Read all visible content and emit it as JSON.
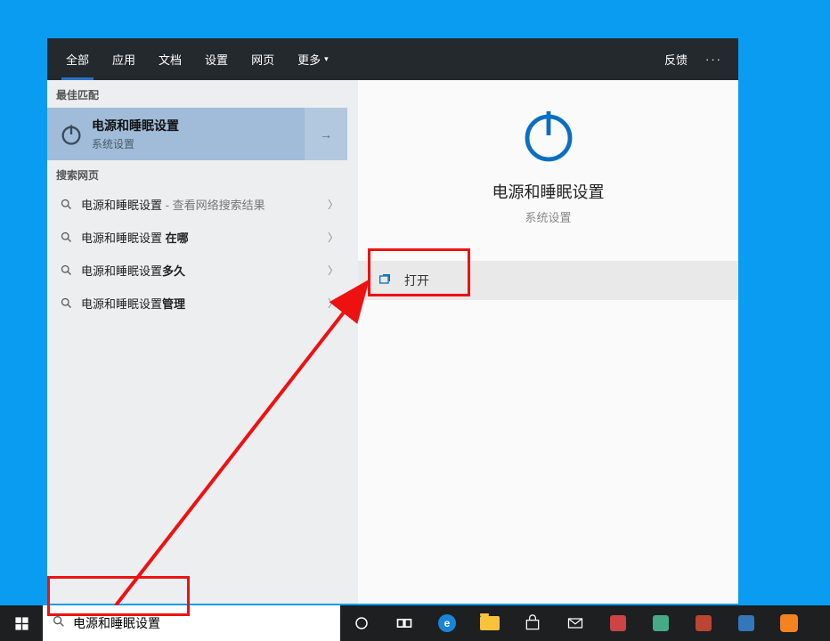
{
  "tabs": [
    "全部",
    "应用",
    "文档",
    "设置",
    "网页",
    "更多"
  ],
  "feedback": "反馈",
  "sections": {
    "best_match": "最佳匹配",
    "web": "搜索网页"
  },
  "best_match": {
    "title": "电源和睡眠设置",
    "subtitle": "系统设置"
  },
  "web_results": [
    {
      "prefix": "电源和睡眠设置",
      "suffix": " - 查看网络搜索结果",
      "bold": ""
    },
    {
      "prefix": "电源和睡眠设置 ",
      "suffix": "",
      "bold": "在哪"
    },
    {
      "prefix": "电源和睡眠设置",
      "suffix": "",
      "bold": "多久"
    },
    {
      "prefix": "电源和睡眠设置",
      "suffix": "",
      "bold": "管理"
    }
  ],
  "detail": {
    "title": "电源和睡眠设置",
    "subtitle": "系统设置",
    "open": "打开"
  },
  "search": {
    "value": "电源和睡眠设置"
  }
}
